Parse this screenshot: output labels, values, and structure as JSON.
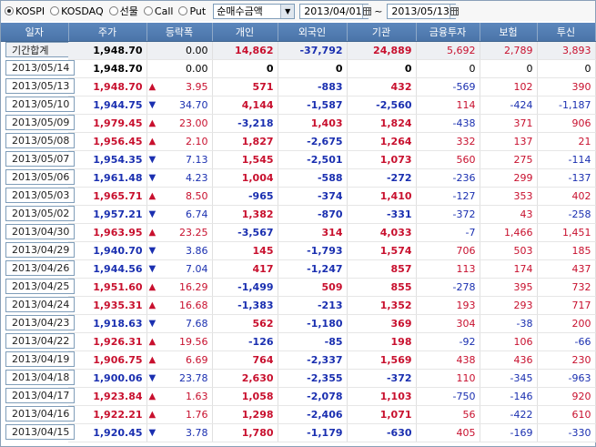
{
  "market_radios": [
    {
      "label": "KOSPI",
      "selected": true
    },
    {
      "label": "KOSDAQ",
      "selected": false
    },
    {
      "label": "선물",
      "selected": false
    },
    {
      "label": "Call",
      "selected": false
    },
    {
      "label": "Put",
      "selected": false
    }
  ],
  "amount_select": {
    "value": "순매수금액"
  },
  "date_from": "2013/04/01",
  "date_to": "2013/05/13",
  "range_sep": "~",
  "columns": [
    "일자",
    "주가",
    "등락폭",
    "개인",
    "외국인",
    "기관",
    "금융투자",
    "보험",
    "투신"
  ],
  "colors": {
    "up": "#c8102e",
    "down": "#1a2fb0",
    "header": "#4a74a8"
  },
  "summary": {
    "date": "기간합계",
    "price": "1,948.70",
    "change": "0.00",
    "individual": "14,862",
    "foreign": "-37,792",
    "institution": "24,889",
    "fin_invest": "5,692",
    "insurance": "2,789",
    "trust": "3,893"
  },
  "rows": [
    {
      "date": "2013/05/14",
      "price": "1,948.70",
      "dir": "flat",
      "change": "0.00",
      "individual": "0",
      "foreign": "0",
      "institution": "0",
      "fin_invest": "0",
      "insurance": "0",
      "trust": "0"
    },
    {
      "date": "2013/05/13",
      "price": "1,948.70",
      "dir": "up",
      "change": "3.95",
      "individual": "571",
      "foreign": "-883",
      "institution": "432",
      "fin_invest": "-569",
      "insurance": "102",
      "trust": "390"
    },
    {
      "date": "2013/05/10",
      "price": "1,944.75",
      "dir": "down",
      "change": "34.70",
      "individual": "4,144",
      "foreign": "-1,587",
      "institution": "-2,560",
      "fin_invest": "114",
      "insurance": "-424",
      "trust": "-1,187"
    },
    {
      "date": "2013/05/09",
      "price": "1,979.45",
      "dir": "up",
      "change": "23.00",
      "individual": "-3,218",
      "foreign": "1,403",
      "institution": "1,824",
      "fin_invest": "-438",
      "insurance": "371",
      "trust": "906"
    },
    {
      "date": "2013/05/08",
      "price": "1,956.45",
      "dir": "up",
      "change": "2.10",
      "individual": "1,827",
      "foreign": "-2,675",
      "institution": "1,264",
      "fin_invest": "332",
      "insurance": "137",
      "trust": "21"
    },
    {
      "date": "2013/05/07",
      "price": "1,954.35",
      "dir": "down",
      "change": "7.13",
      "individual": "1,545",
      "foreign": "-2,501",
      "institution": "1,073",
      "fin_invest": "560",
      "insurance": "275",
      "trust": "-114"
    },
    {
      "date": "2013/05/06",
      "price": "1,961.48",
      "dir": "down",
      "change": "4.23",
      "individual": "1,004",
      "foreign": "-588",
      "institution": "-272",
      "fin_invest": "-236",
      "insurance": "299",
      "trust": "-137"
    },
    {
      "date": "2013/05/03",
      "price": "1,965.71",
      "dir": "up",
      "change": "8.50",
      "individual": "-965",
      "foreign": "-374",
      "institution": "1,410",
      "fin_invest": "-127",
      "insurance": "353",
      "trust": "402"
    },
    {
      "date": "2013/05/02",
      "price": "1,957.21",
      "dir": "down",
      "change": "6.74",
      "individual": "1,382",
      "foreign": "-870",
      "institution": "-331",
      "fin_invest": "-372",
      "insurance": "43",
      "trust": "-258"
    },
    {
      "date": "2013/04/30",
      "price": "1,963.95",
      "dir": "up",
      "change": "23.25",
      "individual": "-3,567",
      "foreign": "314",
      "institution": "4,033",
      "fin_invest": "-7",
      "insurance": "1,466",
      "trust": "1,451"
    },
    {
      "date": "2013/04/29",
      "price": "1,940.70",
      "dir": "down",
      "change": "3.86",
      "individual": "145",
      "foreign": "-1,793",
      "institution": "1,574",
      "fin_invest": "706",
      "insurance": "503",
      "trust": "185"
    },
    {
      "date": "2013/04/26",
      "price": "1,944.56",
      "dir": "down",
      "change": "7.04",
      "individual": "417",
      "foreign": "-1,247",
      "institution": "857",
      "fin_invest": "113",
      "insurance": "174",
      "trust": "437"
    },
    {
      "date": "2013/04/25",
      "price": "1,951.60",
      "dir": "up",
      "change": "16.29",
      "individual": "-1,499",
      "foreign": "509",
      "institution": "855",
      "fin_invest": "-278",
      "insurance": "395",
      "trust": "732"
    },
    {
      "date": "2013/04/24",
      "price": "1,935.31",
      "dir": "up",
      "change": "16.68",
      "individual": "-1,383",
      "foreign": "-213",
      "institution": "1,352",
      "fin_invest": "193",
      "insurance": "293",
      "trust": "717"
    },
    {
      "date": "2013/04/23",
      "price": "1,918.63",
      "dir": "down",
      "change": "7.68",
      "individual": "562",
      "foreign": "-1,180",
      "institution": "369",
      "fin_invest": "304",
      "insurance": "-38",
      "trust": "200"
    },
    {
      "date": "2013/04/22",
      "price": "1,926.31",
      "dir": "up",
      "change": "19.56",
      "individual": "-126",
      "foreign": "-85",
      "institution": "198",
      "fin_invest": "-92",
      "insurance": "106",
      "trust": "-66"
    },
    {
      "date": "2013/04/19",
      "price": "1,906.75",
      "dir": "up",
      "change": "6.69",
      "individual": "764",
      "foreign": "-2,337",
      "institution": "1,569",
      "fin_invest": "438",
      "insurance": "436",
      "trust": "230"
    },
    {
      "date": "2013/04/18",
      "price": "1,900.06",
      "dir": "down",
      "change": "23.78",
      "individual": "2,630",
      "foreign": "-2,355",
      "institution": "-372",
      "fin_invest": "110",
      "insurance": "-345",
      "trust": "-963"
    },
    {
      "date": "2013/04/17",
      "price": "1,923.84",
      "dir": "up",
      "change": "1.63",
      "individual": "1,058",
      "foreign": "-2,078",
      "institution": "1,103",
      "fin_invest": "-750",
      "insurance": "-146",
      "trust": "920"
    },
    {
      "date": "2013/04/16",
      "price": "1,922.21",
      "dir": "up",
      "change": "1.76",
      "individual": "1,298",
      "foreign": "-2,406",
      "institution": "1,071",
      "fin_invest": "56",
      "insurance": "-422",
      "trust": "610"
    },
    {
      "date": "2013/04/15",
      "price": "1,920.45",
      "dir": "down",
      "change": "3.78",
      "individual": "1,780",
      "foreign": "-1,179",
      "institution": "-630",
      "fin_invest": "405",
      "insurance": "-169",
      "trust": "-330"
    }
  ]
}
